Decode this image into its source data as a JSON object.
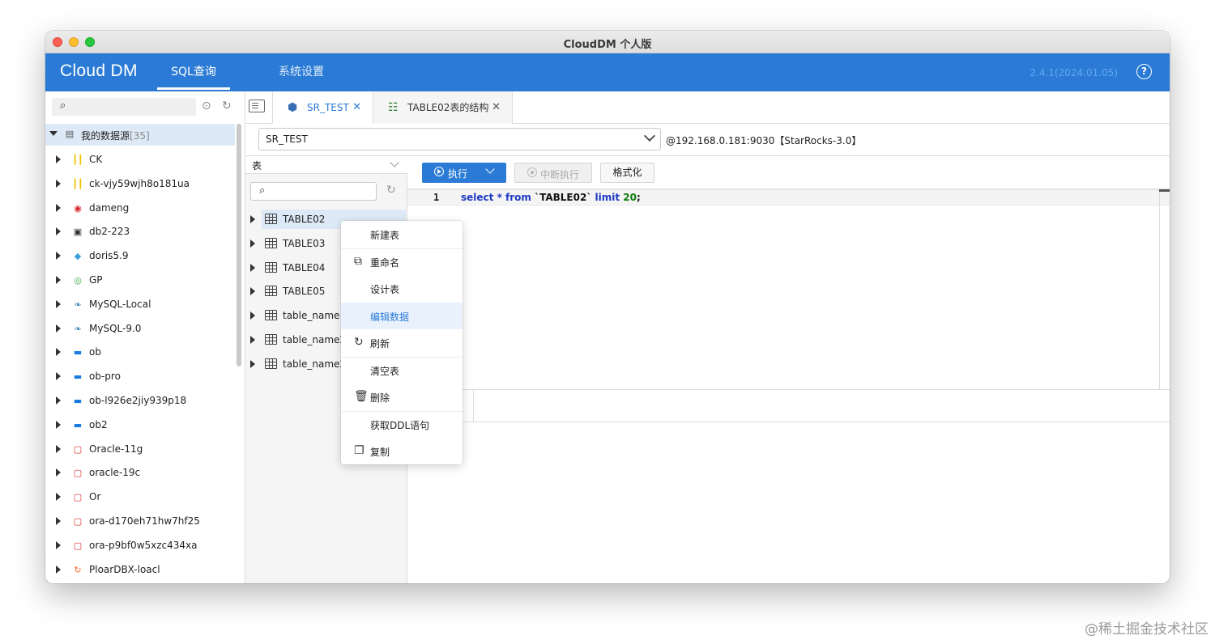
{
  "window": {
    "title": "CloudDM 个人版"
  },
  "header": {
    "logo": "Cloud DM",
    "nav": [
      {
        "label": "SQL查询"
      },
      {
        "label": "系统设置"
      }
    ],
    "version": "2.4.1(2024.01.05)",
    "help_label": "?"
  },
  "left_panel": {
    "search_placeholder": "",
    "root": {
      "label": "我的数据源",
      "count": "[35]"
    },
    "items": [
      {
        "label": "CK",
        "icon": "clickhouse-icon",
        "color": "#f2c200"
      },
      {
        "label": "ck-vjy59wjh8o181ua",
        "icon": "clickhouse-icon",
        "color": "#f2c200"
      },
      {
        "label": "dameng",
        "icon": "dameng-icon",
        "color": "#d6242b"
      },
      {
        "label": "db2-223",
        "icon": "db2-icon",
        "color": "#333333"
      },
      {
        "label": "doris5.9",
        "icon": "doris-icon",
        "color": "#3f9fd9"
      },
      {
        "label": "GP",
        "icon": "greenplum-icon",
        "color": "#39a845"
      },
      {
        "label": "MySQL-Local",
        "icon": "mysql-icon",
        "color": "#4d8fc0"
      },
      {
        "label": "MySQL-9.0",
        "icon": "mysql-icon",
        "color": "#4d8fc0"
      },
      {
        "label": "ob",
        "icon": "oceanbase-icon",
        "color": "#1a7ce0"
      },
      {
        "label": "ob-pro",
        "icon": "oceanbase-icon",
        "color": "#1a7ce0"
      },
      {
        "label": "ob-l926e2jiy939p18",
        "icon": "oceanbase-icon",
        "color": "#1a7ce0"
      },
      {
        "label": "ob2",
        "icon": "oceanbase-icon",
        "color": "#1a7ce0"
      },
      {
        "label": "Oracle-11g",
        "icon": "oracle-icon",
        "color": "#d9312a"
      },
      {
        "label": "oracle-19c",
        "icon": "oracle-icon",
        "color": "#d9312a"
      },
      {
        "label": "Or",
        "icon": "oracle-icon",
        "color": "#d9312a"
      },
      {
        "label": "ora-d170eh71hw7hf25",
        "icon": "oracle-icon",
        "color": "#d9312a"
      },
      {
        "label": "ora-p9bf0w5xzc434xa",
        "icon": "oracle-icon",
        "color": "#d9312a"
      },
      {
        "label": "PloarDBX-loacl",
        "icon": "polardbx-icon",
        "color": "#f26b21"
      }
    ]
  },
  "tabs": [
    {
      "label": "SR_TEST",
      "icon": "starrocks-icon",
      "active": true
    },
    {
      "label": "TABLE02表的结构",
      "icon": "structure-icon",
      "active": false
    }
  ],
  "datasource": {
    "selected": "SR_TEST",
    "info": "@192.168.0.181:9030【StarRocks-3.0】"
  },
  "object_panel": {
    "type": "表",
    "search_placeholder": "",
    "tables": [
      {
        "label": "TABLE02",
        "selected": true
      },
      {
        "label": "TABLE03"
      },
      {
        "label": "TABLE04"
      },
      {
        "label": "TABLE05"
      },
      {
        "label": "table_name"
      },
      {
        "label": "table_name2"
      },
      {
        "label": "table_name2"
      }
    ]
  },
  "toolbar": {
    "run_label": "执行",
    "stop_label": "中断执行",
    "format_label": "格式化"
  },
  "editor": {
    "line_number": "1",
    "tokens": [
      {
        "text": "select",
        "kind": "kw"
      },
      {
        "text": " * ",
        "kind": "kw"
      },
      {
        "text": "from",
        "kind": "kw"
      },
      {
        "text": " `TABLE02` ",
        "kind": "id"
      },
      {
        "text": "limit",
        "kind": "kw"
      },
      {
        "text": " 20",
        "kind": "num"
      },
      {
        "text": ";",
        "kind": "id"
      }
    ]
  },
  "context_menu": {
    "items": [
      {
        "label": "新建表",
        "icon": ""
      },
      {
        "label": "重命名",
        "icon": "rename-icon"
      },
      {
        "label": "设计表",
        "icon": ""
      },
      {
        "label": "编辑数据",
        "icon": "",
        "hover": true
      },
      {
        "label": "刷新",
        "icon": "refresh-icon"
      },
      {
        "label": "清空表",
        "icon": ""
      },
      {
        "label": "删除",
        "icon": "trash-icon"
      },
      {
        "label": "获取DDL语句",
        "icon": ""
      },
      {
        "label": "复制",
        "icon": "copy-icon"
      }
    ]
  },
  "watermark": "@稀土掘金技术社区"
}
